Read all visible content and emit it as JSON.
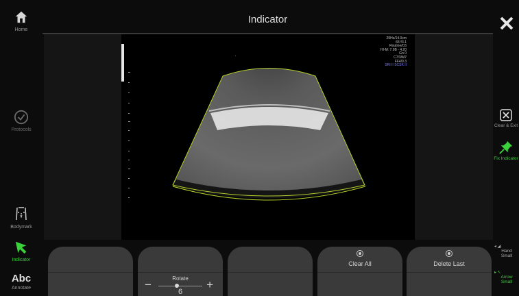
{
  "header": {
    "title": "Indicator"
  },
  "left_nav": {
    "home": "Home",
    "protocols": "Protocols",
    "bodymark": "Bodymark",
    "indicator": "Indicator",
    "annotate_icon": "Abc",
    "annotate": "Annotate"
  },
  "image_params": {
    "lines": [
      "29Hz/14.0cm",
      "65°/3.1",
      "Routine/C6",
      "HI-M: 7.9B - 4.20",
      "Gn   0",
      "C7/3/M7",
      "FF4/0.3"
    ],
    "blue_line": "SRI II  SCSK II"
  },
  "right_nav": {
    "clear_exit": "Clear & Exit",
    "fix_indicator": "Fix Indicator",
    "hand_small": [
      "Hand",
      "Small"
    ],
    "arrow_small": [
      "Arrow",
      "Small"
    ]
  },
  "bottom": {
    "rotate_label": "Rotate",
    "rotate_value": "6",
    "clear_all": "Clear All",
    "delete_last": "Delete Last"
  },
  "colors": {
    "accent_green": "#3bd13b",
    "sector_outline": "#b7d22a",
    "button_bg": "#3a3a3a"
  },
  "icons": [
    "home-icon",
    "check-circle-icon",
    "bodymark-icon",
    "arrow-pointer-icon",
    "close-icon",
    "close-box-icon",
    "pin-icon"
  ]
}
